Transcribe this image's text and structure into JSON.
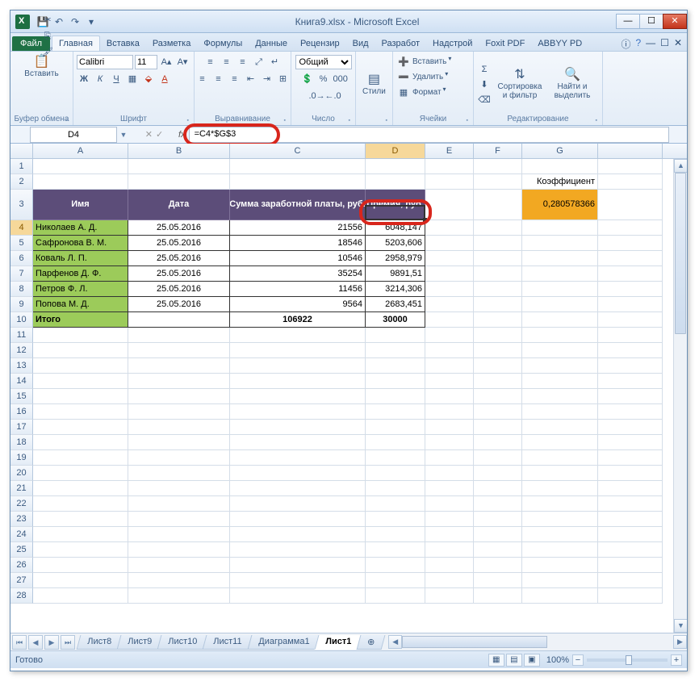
{
  "title": "Книга9.xlsx - Microsoft Excel",
  "ribbon": {
    "file": "Файл",
    "tabs": [
      "Главная",
      "Вставка",
      "Разметка",
      "Формулы",
      "Данные",
      "Рецензир",
      "Вид",
      "Разработ",
      "Надстрой",
      "Foxit PDF",
      "ABBYY PD"
    ],
    "active_tab": 0,
    "groups": {
      "clipboard": {
        "paste": "Вставить",
        "label": "Буфер обмена"
      },
      "font": {
        "name": "Calibri",
        "size": "11",
        "label": "Шрифт"
      },
      "align": {
        "label": "Выравнивание"
      },
      "number": {
        "format": "Общий",
        "label": "Число"
      },
      "styles": {
        "btn": "Стили"
      },
      "cells": {
        "insert": "Вставить",
        "delete": "Удалить",
        "format": "Формат",
        "label": "Ячейки"
      },
      "editing": {
        "sort": "Сортировка и фильтр",
        "find": "Найти и выделить",
        "label": "Редактирование"
      }
    }
  },
  "name_box": "D4",
  "formula": "=C4*$G$3",
  "columns": [
    "A",
    "B",
    "C",
    "D",
    "E",
    "F",
    "G"
  ],
  "active_cell": "D4",
  "data": {
    "coef_label": "Коэффициент",
    "coef_value": "0,280578366",
    "headers": {
      "name": "Имя",
      "date": "Дата",
      "salary": "Сумма заработной платы, руб.",
      "bonus": "Премия, руб."
    },
    "rows": [
      {
        "name": "Николаев А. Д.",
        "date": "25.05.2016",
        "salary": "21556",
        "bonus": "6048,147"
      },
      {
        "name": "Сафронова В. М.",
        "date": "25.05.2016",
        "salary": "18546",
        "bonus": "5203,606"
      },
      {
        "name": "Коваль Л. П.",
        "date": "25.05.2016",
        "salary": "10546",
        "bonus": "2958,979"
      },
      {
        "name": "Парфенов Д. Ф.",
        "date": "25.05.2016",
        "salary": "35254",
        "bonus": "9891,51"
      },
      {
        "name": "Петров Ф. Л.",
        "date": "25.05.2016",
        "salary": "11456",
        "bonus": "3214,306"
      },
      {
        "name": "Попова М. Д.",
        "date": "25.05.2016",
        "salary": "9564",
        "bonus": "2683,451"
      }
    ],
    "total": {
      "name": "Итого",
      "salary": "106922",
      "bonus": "30000"
    }
  },
  "sheets": [
    "Лист8",
    "Лист9",
    "Лист10",
    "Лист11",
    "Диаграмма1",
    "Лист1"
  ],
  "active_sheet": 5,
  "status": "Готово",
  "zoom": "100%"
}
